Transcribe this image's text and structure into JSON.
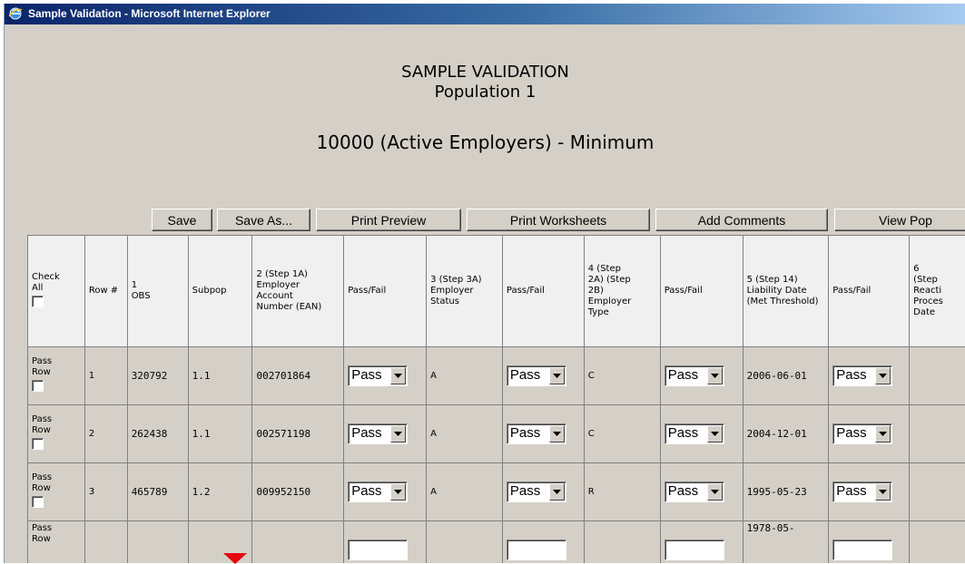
{
  "window": {
    "title": "Sample Validation - Microsoft Internet Explorer"
  },
  "page": {
    "heading1": "SAMPLE VALIDATION",
    "heading2": "Population 1",
    "heading3": "10000 (Active Employers) - Minimum"
  },
  "toolbar": {
    "save": "Save",
    "save_as": "Save As...",
    "print_preview": "Print Preview",
    "print_worksheets": "Print Worksheets",
    "add_comments": "Add Comments",
    "view_pop": "View Pop"
  },
  "table": {
    "headers": {
      "check_all": "Check All",
      "row_num": "Row #",
      "obs": "1 OBS",
      "subpop": "Subpop",
      "ean": "2 (Step 1A) Employer Account Number (EAN)",
      "pf1": "Pass/Fail",
      "status": "3 (Step 3A) Employer Status",
      "pf2": "Pass/Fail",
      "type": "4 (Step 2A) (Step 2B) Employer Type",
      "pf3": "Pass/Fail",
      "liability": "5 (Step 14) Liability Date (Met Threshold)",
      "pf4": "Pass/Fail",
      "reactivation": "6 (Step Reacti Proces Date"
    },
    "pass_row_label": "Pass Row",
    "rows": [
      {
        "row": "1",
        "obs": "320792",
        "subpop": "1.1",
        "ean": "002701864",
        "pf1": "Pass",
        "status": "A",
        "pf2": "Pass",
        "type": "C",
        "pf3": "Pass",
        "liability": "2006-06-01",
        "pf4": "Pass"
      },
      {
        "row": "2",
        "obs": "262438",
        "subpop": "1.1",
        "ean": "002571198",
        "pf1": "Pass",
        "status": "A",
        "pf2": "Pass",
        "type": "C",
        "pf3": "Pass",
        "liability": "2004-12-01",
        "pf4": "Pass"
      },
      {
        "row": "3",
        "obs": "465789",
        "subpop": "1.2",
        "ean": "009952150",
        "pf1": "Pass",
        "status": "A",
        "pf2": "Pass",
        "type": "R",
        "pf3": "Pass",
        "liability": "1995-05-23",
        "pf4": "Pass"
      },
      {
        "row": "",
        "obs": "",
        "subpop": "",
        "ean": "",
        "pf1": "",
        "status": "",
        "pf2": "",
        "type": "",
        "pf3": "",
        "liability": "1978-05-",
        "pf4": ""
      }
    ]
  },
  "colors": {
    "title_bar": "#0a246a",
    "window_bg": "#d4d0c8",
    "cursor": "#e8000b"
  }
}
